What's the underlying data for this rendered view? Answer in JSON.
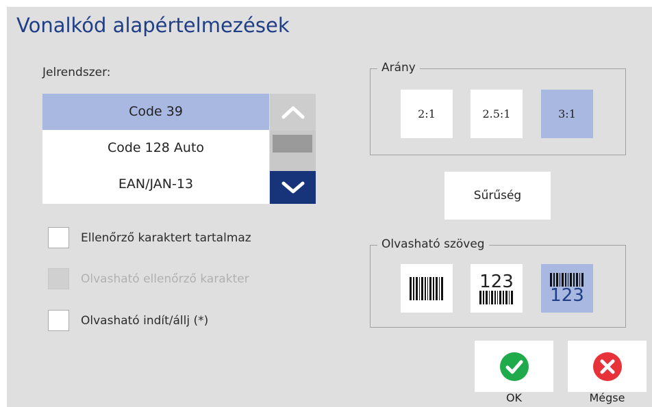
{
  "title": "Vonalkód alapértelmezések",
  "symbology": {
    "label": "Jelrendszer:",
    "items": [
      "Code 39",
      "Code 128 Auto",
      "EAN/JAN-13"
    ],
    "selected": "Code 39"
  },
  "checkboxes": [
    {
      "label": "Ellenőrző karaktert tartalmaz",
      "checked": false,
      "enabled": true
    },
    {
      "label": "Olvasható ellenőrző karakter",
      "checked": false,
      "enabled": false
    },
    {
      "label": "Olvasható indít/állj (*)",
      "checked": false,
      "enabled": true
    }
  ],
  "ratio": {
    "legend": "Arány",
    "options": [
      "2:1",
      "2.5:1",
      "3:1"
    ],
    "selected": "3:1"
  },
  "density_label": "Sűrűség",
  "readable_text": {
    "legend": "Olvasható szöveg",
    "number": "123",
    "options": [
      "barcode-no-text-icon",
      "text-above-barcode-icon",
      "text-below-barcode-icon"
    ],
    "selected": "text-below-barcode-icon"
  },
  "ok_label": "OK",
  "cancel_label": "Mégse",
  "colors": {
    "title": "#1f3e86",
    "selection": "#a8b8e0",
    "scroll_down": "#17347a",
    "ok": "#1faa4c",
    "cancel": "#e8323a"
  }
}
